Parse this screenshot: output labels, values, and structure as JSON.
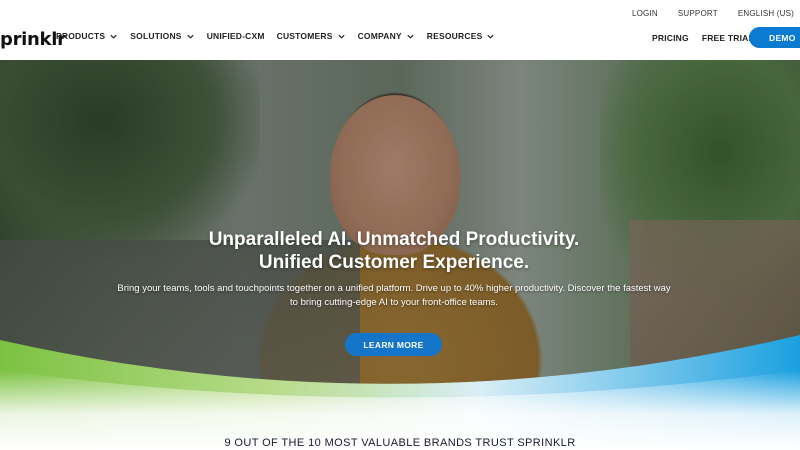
{
  "header": {
    "logo": "prinklr",
    "nav": [
      {
        "label": "PRODUCTS",
        "has_dropdown": true
      },
      {
        "label": "SOLUTIONS",
        "has_dropdown": true
      },
      {
        "label": "UNIFIED-CXM",
        "has_dropdown": false
      },
      {
        "label": "CUSTOMERS",
        "has_dropdown": true
      },
      {
        "label": "COMPANY",
        "has_dropdown": true
      },
      {
        "label": "RESOURCES",
        "has_dropdown": true
      }
    ],
    "utility": {
      "login": "LOGIN",
      "support": "SUPPORT",
      "language": "ENGLISH (US)"
    },
    "pricing": "PRICING",
    "free_trial": "FREE TRIAL",
    "demo": "DEMO"
  },
  "hero": {
    "title_line1": "Unparalleled AI. Unmatched Productivity.",
    "title_line2": "Unified Customer Experience.",
    "subtitle_line1": "Bring your teams, tools and touchpoints together on a unified platform. Drive up to 40% higher productivity. Discover the fastest way",
    "subtitle_line2": "to bring cutting-edge AI to your front-office teams.",
    "cta": "LEARN MORE"
  },
  "trust_banner": "9 OUT OF THE 10 MOST VALUABLE BRANDS TRUST SPRINKLR",
  "colors": {
    "primary_button": "#1475c9",
    "wave_green": "#7cc242",
    "wave_blue": "#1aa0e0"
  }
}
